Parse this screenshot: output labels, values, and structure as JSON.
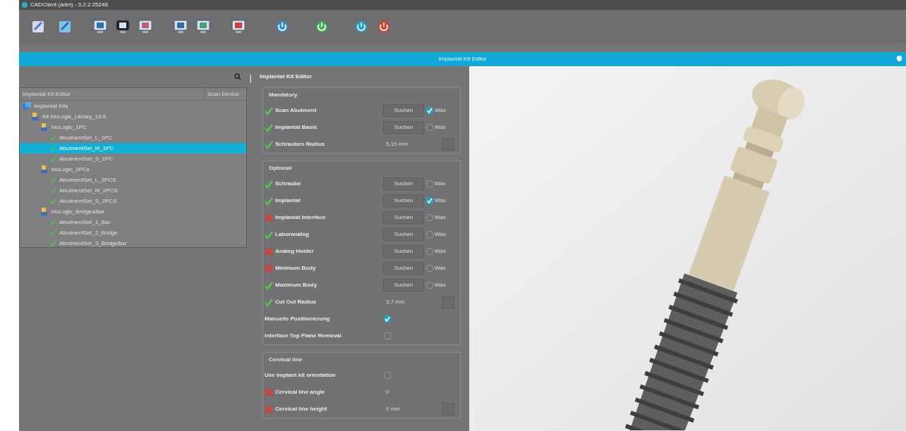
{
  "window": {
    "title": "CADClient (adm) - 3.2.2.25248"
  },
  "banner": {
    "title": "Implantat Kit Editor"
  },
  "tree_panel": {
    "column_1": "Implantat Kit Editor",
    "column_2": "Scan Device",
    "items": [
      {
        "label": "Implantat Kits",
        "kind": "root",
        "selected": false,
        "children": [
          {
            "label": "Kit bioLogic_Library_13.5",
            "kind": "kit",
            "selected": false,
            "children": [
              {
                "label": "bioLogic_1PC",
                "kind": "kit",
                "selected": false,
                "children": [
                  {
                    "label": "AbutmentSet_L_1PC",
                    "kind": "set",
                    "selected": false
                  },
                  {
                    "label": "AbutmentSet_M_1PC",
                    "kind": "set",
                    "selected": true
                  },
                  {
                    "label": "AbutmentSet_S_1PC",
                    "kind": "set",
                    "selected": false
                  }
                ]
              },
              {
                "label": "bioLogic_2PCs",
                "kind": "kit",
                "selected": false,
                "children": [
                  {
                    "label": "AbutmentSet_L_2PCS",
                    "kind": "set",
                    "selected": false
                  },
                  {
                    "label": "AbutmentSet_M_2PCS",
                    "kind": "set",
                    "selected": false
                  },
                  {
                    "label": "AbutmentSet_S_2PCS",
                    "kind": "set",
                    "selected": false
                  }
                ]
              },
              {
                "label": "bioLogic_Bridge&Bar",
                "kind": "kit",
                "selected": false,
                "children": [
                  {
                    "label": "AbutmentSet_1_Bar",
                    "kind": "set",
                    "selected": false
                  },
                  {
                    "label": "AbutmentSet_2_Bridge",
                    "kind": "set",
                    "selected": false
                  },
                  {
                    "label": "AbutmentSet_3_BridgeBar",
                    "kind": "set",
                    "selected": false
                  }
                ]
              }
            ]
          }
        ]
      }
    ]
  },
  "editor": {
    "title": "Implantat Kit Editor",
    "sections": [
      {
        "title": "Mandatory",
        "rows": [
          {
            "kind": "search",
            "valid": true,
            "label": "Scan Abutment",
            "button": "Suchen",
            "option": "Wax",
            "checked": true
          },
          {
            "kind": "search",
            "valid": true,
            "label": "Implantat Basis",
            "button": "Suchen",
            "option": "Wax",
            "checked": false
          },
          {
            "kind": "value",
            "valid": true,
            "label": "Schrauben Radius",
            "value": "5,15 mm"
          }
        ]
      },
      {
        "title": "Optional",
        "rows": [
          {
            "kind": "search",
            "valid": true,
            "label": "Schraube",
            "button": "Suchen",
            "option": "Wax",
            "checked": false
          },
          {
            "kind": "search",
            "valid": true,
            "label": "Implantat",
            "button": "Suchen",
            "option": "Wax",
            "checked": true
          },
          {
            "kind": "search",
            "valid": false,
            "label": "Implantat Interface",
            "button": "Suchen",
            "option": "Wax",
            "checked": false
          },
          {
            "kind": "search",
            "valid": true,
            "label": "Laboranalog",
            "button": "Suchen",
            "option": "Wax",
            "checked": false
          },
          {
            "kind": "search",
            "valid": false,
            "label": "Analog Holder",
            "button": "Suchen",
            "option": "Wax",
            "checked": false
          },
          {
            "kind": "search",
            "valid": false,
            "label": "Minimum Body",
            "button": "Suchen",
            "option": "Wax",
            "checked": false
          },
          {
            "kind": "search",
            "valid": true,
            "label": "Maximum Body",
            "button": "Suchen",
            "option": "Wax",
            "checked": false
          },
          {
            "kind": "value",
            "valid": true,
            "label": "Cut Out Radius",
            "value": "3,7 mm"
          },
          {
            "kind": "check",
            "label": "Manuelle Positionierung",
            "checked": true
          },
          {
            "kind": "check",
            "label": "Interface Top Plane Removal",
            "checked": false
          }
        ]
      },
      {
        "title": "Cervical line",
        "rows": [
          {
            "kind": "check",
            "label": "Use implant kit orientation",
            "checked": false
          },
          {
            "kind": "number",
            "valid": false,
            "label": "Cervical line angle",
            "value": "0"
          },
          {
            "kind": "value",
            "valid": false,
            "label": "Cervical line height",
            "value": "0 mm"
          }
        ]
      }
    ]
  }
}
